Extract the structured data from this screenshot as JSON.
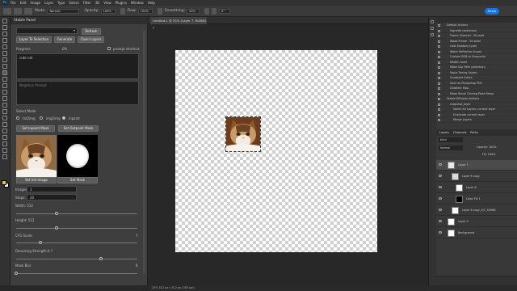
{
  "menu": {
    "items": [
      "File",
      "Edit",
      "Image",
      "Layer",
      "Type",
      "Select",
      "Filter",
      "3D",
      "View",
      "Plugins",
      "Window",
      "Help"
    ]
  },
  "options": {
    "mode_label": "Mode:",
    "mode_value": "Normal",
    "opacity_label": "Opacity:",
    "opacity_value": "100%",
    "flow_label": "Flow:",
    "flow_value": "100%",
    "smoothing_label": "Smoothing:",
    "smoothing_value": "20%",
    "angle_value": "0°",
    "share_label": "Share"
  },
  "plugin": {
    "title": "Stable Panel",
    "refresh_label": "Refresh",
    "layer_to_selection_label": "Layer To Selection",
    "generate_label": "Generate",
    "clean_layers_label": "Clean Layers",
    "progress_label": "Progress:",
    "progress_value": "0%",
    "prompt_shortcut_label": "prompt shortcut",
    "prompt_text": "cute cat",
    "negative_prompt_placeholder": "Negative Prompt",
    "select_mode_label": "Select Mode",
    "modes": [
      "txt2img",
      "img2img",
      "inpaint"
    ],
    "selected_mode": "inpaint",
    "set_inpaint_mask_label": "Set Inpaint Mask",
    "set_outpaint_mask_label": "Set Outpaint Mask",
    "set_init_image_label": "Set Init Image",
    "set_mask_label": "Set Mask",
    "images_label": "Images:",
    "images_value": "1",
    "steps_label": "Steps:",
    "steps_value": "20",
    "width_label": "Width: 512",
    "height_label": "Height: 512",
    "cfg_label": "CFG Scale:",
    "cfg_value": "7",
    "denoise_label": "Denoising Strength:0.7",
    "mask_blur_label": "Mask Blur",
    "mask_blur_value": "8",
    "width_fraction": 0.33,
    "height_fraction": 0.33,
    "cfg_fraction": 0.2,
    "denoise_fraction": 0.7,
    "mask_blur_fraction": 0.0
  },
  "document": {
    "tab_title": "Untitled-1 @ 25% (Layer 7, RGB/8) *",
    "status_text": "25%   512 px x 512 px (300 ppi)"
  },
  "actions": {
    "rows": [
      "Default Actions",
      "Vignette (selection)",
      "Frame Channel - 50 pixel",
      "Wood Frame - 50 pixel",
      "Cast Shadow (type)",
      "Water Reflection (type)",
      "Custom RGB to Grayscale",
      "Molten Lead",
      "Make Clip Path (selection)",
      "Sepia Toning (layer)",
      "Quadrant Colors",
      "Save as Photoshop PDF",
      "Gradient Map",
      "Mixer Brush Cloning Paint Setup",
      "Stable Diffusion Actions",
      "snapshot_layer",
      "Select All Layers: current layer",
      "Duplicate current layer",
      "Merge Layers"
    ]
  },
  "layers": {
    "tabs": [
      "Layers",
      "Channels",
      "Paths"
    ],
    "kind_label": "Kind",
    "blend_mode": "Normal",
    "opacity_label": "Opacity: 100%",
    "fill_label": "Fill: 100%",
    "rows": [
      "Layer 7",
      "Layer 6 copy",
      "Layer 6",
      "Color Fill 1",
      "Layer 6 copy_0/7_03568",
      "Layer 3",
      "Background"
    ]
  }
}
